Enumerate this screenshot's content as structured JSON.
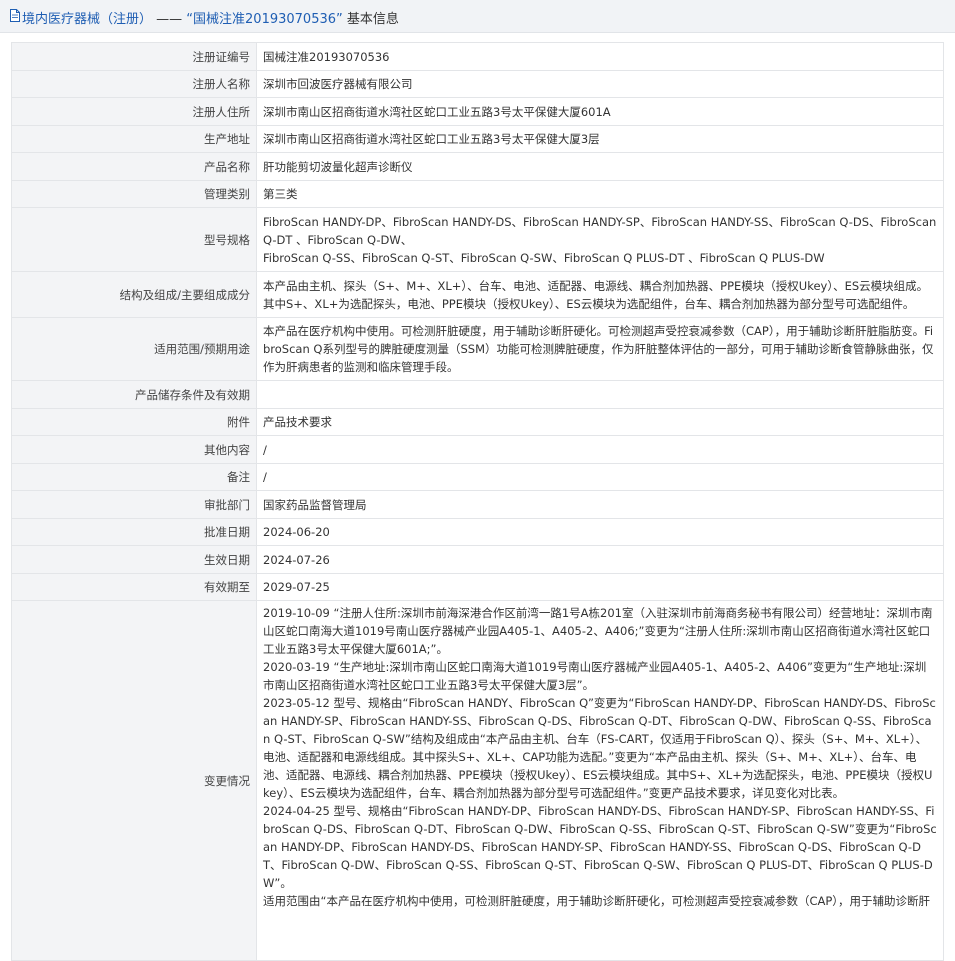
{
  "header": {
    "prefix": "境内医疗器械（注册）",
    "sep": "——",
    "reg_quoted": "“国械注准20193070536”",
    "suffix": "基本信息"
  },
  "rows": [
    {
      "label": "注册证编号",
      "value": "国械注准20193070536"
    },
    {
      "label": "注册人名称",
      "value": "深圳市回波医疗器械有限公司"
    },
    {
      "label": "注册人住所",
      "value": "深圳市南山区招商街道水湾社区蛇口工业五路3号太平保健大厦601A"
    },
    {
      "label": "生产地址",
      "value": "深圳市南山区招商街道水湾社区蛇口工业五路3号太平保健大厦3层"
    },
    {
      "label": "产品名称",
      "value": "肝功能剪切波量化超声诊断仪"
    },
    {
      "label": "管理类别",
      "value": "第三类"
    },
    {
      "label": "型号规格",
      "value": "FibroScan HANDY-DP、FibroScan HANDY-DS、FibroScan HANDY-SP、FibroScan HANDY-SS、FibroScan Q-DS、FibroScan Q-DT 、FibroScan Q-DW、\nFibroScan Q-SS、FibroScan Q-ST、FibroScan Q-SW、FibroScan Q PLUS-DT 、FibroScan Q PLUS-DW"
    },
    {
      "label": "结构及组成/主要组成成分",
      "value": "本产品由主机、探头（S+、M+、XL+）、台车、电池、适配器、电源线、耦合剂加热器、PPE模块（授权Ukey）、ES云模块组成。其中S+、XL+为选配探头，电池、PPE模块（授权Ukey）、ES云模块为选配组件，台车、耦合剂加热器为部分型号可选配组件。"
    },
    {
      "label": "适用范围/预期用途",
      "value": "本产品在医疗机构中使用。可检测肝脏硬度，用于辅助诊断肝硬化。可检测超声受控衰减参数（CAP），用于辅助诊断肝脏脂肪变。FibroScan Q系列型号的脾脏硬度测量（SSM）功能可检测脾脏硬度，作为肝脏整体评估的一部分，可用于辅助诊断食管静脉曲张，仅作为肝病患者的监测和临床管理手段。"
    },
    {
      "label": "产品储存条件及有效期",
      "value": ""
    },
    {
      "label": "附件",
      "value": "产品技术要求"
    },
    {
      "label": "其他内容",
      "value": "/"
    },
    {
      "label": "备注",
      "value": "/"
    },
    {
      "label": "审批部门",
      "value": "国家药品监督管理局"
    },
    {
      "label": "批准日期",
      "value": "2024-06-20"
    },
    {
      "label": "生效日期",
      "value": "2024-07-26"
    },
    {
      "label": "有效期至",
      "value": "2029-07-25"
    },
    {
      "label": "变更情况",
      "value": "2019-10-09 “注册人住所:深圳市前海深港合作区前湾一路1号A栋201室（入驻深圳市前海商务秘书有限公司）经营地址：深圳市南山区蛇口南海大道1019号南山医疗器械产业园A405-1、A405-2、A406;”变更为“注册人住所:深圳市南山区招商街道水湾社区蛇口工业五路3号太平保健大厦601A;”。\n2020-03-19 “生产地址:深圳市南山区蛇口南海大道1019号南山医疗器械产业园A405-1、A405-2、A406”变更为“生产地址:深圳市南山区招商街道水湾社区蛇口工业五路3号太平保健大厦3层”。\n2023-05-12 型号、规格由“FibroScan HANDY、FibroScan Q”变更为“FibroScan HANDY-DP、FibroScan HANDY-DS、FibroScan HANDY-SP、FibroScan HANDY-SS、FibroScan Q-DS、FibroScan Q-DT、FibroScan Q-DW、FibroScan Q-SS、FibroScan Q-ST、FibroScan Q-SW”结构及组成由“本产品由主机、台车（FS-CART，仅适用于FibroScan Q）、探头（S+、M+、XL+）、电池、适配器和电源线组成。其中探头S+、XL+、CAP功能为选配。”变更为“本产品由主机、探头（S+、M+、XL+）、台车、电池、适配器、电源线、耦合剂加热器、PPE模块（授权Ukey）、ES云模块组成。其中S+、XL+为选配探头，电池、PPE模块（授权Ukey）、ES云模块为选配组件，台车、耦合剂加热器为部分型号可选配组件。”变更产品技术要求，详见变化对比表。\n2024-04-25 型号、规格由“FibroScan HANDY-DP、FibroScan HANDY-DS、FibroScan HANDY-SP、FibroScan HANDY-SS、FibroScan Q-DS、FibroScan Q-DT、FibroScan Q-DW、FibroScan Q-SS、FibroScan Q-ST、FibroScan Q-SW”变更为“FibroScan HANDY-DP、FibroScan HANDY-DS、FibroScan HANDY-SP、FibroScan HANDY-SS、FibroScan Q-DS、FibroScan Q-DT、FibroScan Q-DW、FibroScan Q-SS、FibroScan Q-ST、FibroScan Q-SW、FibroScan Q PLUS-DT、FibroScan Q PLUS-DW”。\n适用范围由“本产品在医疗机构中使用，可检测肝脏硬度，用于辅助诊断肝硬化，可检测超声受控衰减参数（CAP），用于辅助诊断肝"
    }
  ]
}
